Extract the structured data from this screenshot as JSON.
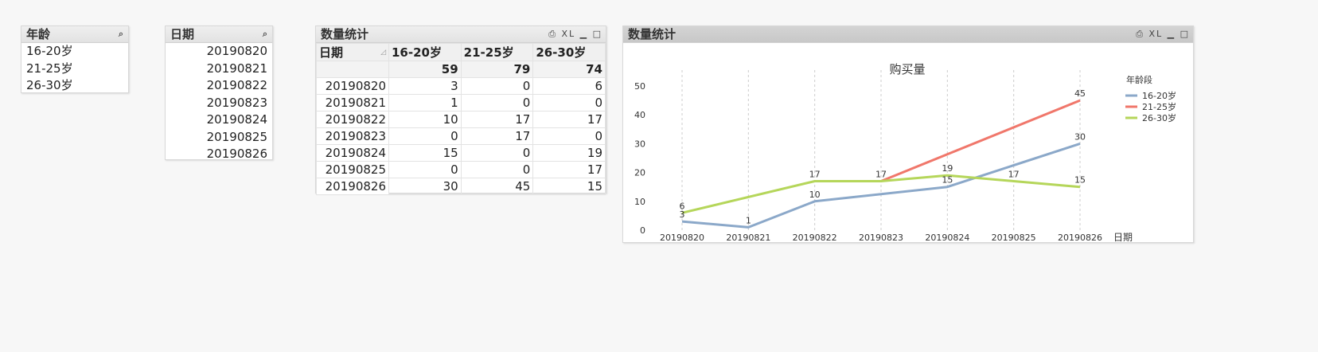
{
  "age_listbox": {
    "title": "年龄",
    "items": [
      "16-20岁",
      "21-25岁",
      "26-30岁"
    ]
  },
  "date_listbox": {
    "title": "日期",
    "items": [
      "20190820",
      "20190821",
      "20190822",
      "20190823",
      "20190824",
      "20190825",
      "20190826"
    ]
  },
  "pivot": {
    "title": "数量统计",
    "row_header": "日期",
    "columns": [
      "16-20岁",
      "21-25岁",
      "26-30岁"
    ],
    "totals": [
      "59",
      "79",
      "74"
    ],
    "rows": [
      {
        "date": "20190820",
        "values": [
          "3",
          "0",
          "6"
        ]
      },
      {
        "date": "20190821",
        "values": [
          "1",
          "0",
          "0"
        ]
      },
      {
        "date": "20190822",
        "values": [
          "10",
          "17",
          "17"
        ]
      },
      {
        "date": "20190823",
        "values": [
          "0",
          "17",
          "0"
        ]
      },
      {
        "date": "20190824",
        "values": [
          "15",
          "0",
          "19"
        ]
      },
      {
        "date": "20190825",
        "values": [
          "0",
          "0",
          "17"
        ]
      },
      {
        "date": "20190826",
        "values": [
          "30",
          "45",
          "15"
        ]
      }
    ],
    "tools": "⎙ XL ▁ □"
  },
  "chart_panel": {
    "title": "数量统计",
    "tools": "⎙ XL ▁ □"
  },
  "chart_data": {
    "type": "line",
    "title": "购买量",
    "xlabel": "日期",
    "ylabel": "",
    "legend_title": "年龄段",
    "legend_position": "top-right",
    "x": [
      "20190820",
      "20190821",
      "20190822",
      "20190823",
      "20190824",
      "20190825",
      "20190826"
    ],
    "ylim": [
      0,
      50
    ],
    "yticks": [
      0,
      10,
      20,
      30,
      40,
      50
    ],
    "grid": "vertical-dashed",
    "series": [
      {
        "name": "16-20岁",
        "color": "#8ba8c9",
        "values": [
          3,
          1,
          10,
          null,
          15,
          null,
          30
        ],
        "labels": [
          "3",
          "1",
          "10",
          "",
          "15",
          "",
          "30"
        ]
      },
      {
        "name": "21-25岁",
        "color": "#f0776b",
        "values": [
          null,
          null,
          17,
          17,
          null,
          null,
          45
        ],
        "labels": [
          "",
          "",
          "",
          "",
          "",
          "",
          "45"
        ]
      },
      {
        "name": "26-30岁",
        "color": "#b5d65a",
        "values": [
          6,
          null,
          17,
          17,
          19,
          17,
          15
        ],
        "labels": [
          "6",
          "",
          "17",
          "17",
          "19",
          "17",
          "15"
        ]
      }
    ]
  }
}
